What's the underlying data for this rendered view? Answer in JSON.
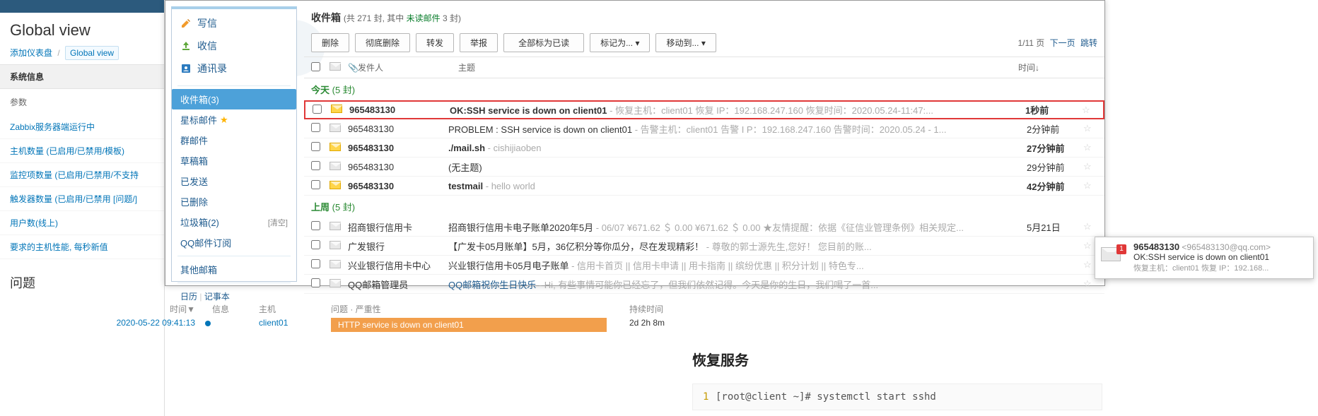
{
  "zabbix": {
    "title": "Global view",
    "bc_add": "添加仪表盘",
    "bc_cur": "Global view",
    "sysinfo_hd": "系统信息",
    "param": "参数",
    "links": [
      "Zabbix服务器端运行中",
      "主机数量 (已启用/已禁用/模板)",
      "监控项数量 (已启用/已禁用/不支持",
      "触发器数量 (已启用/已禁用 [问题/]",
      "用户数(线上)",
      "要求的主机性能, 每秒新值"
    ],
    "problems_hd": "问题"
  },
  "sidebar": {
    "compose": "写信",
    "receive": "收信",
    "contacts": "通讯录",
    "folders": {
      "inbox": "收件箱(3)",
      "starred": "星标邮件",
      "group": "群邮件",
      "drafts": "草稿箱",
      "sent": "已发送",
      "deleted": "已删除",
      "junk": "垃圾箱(2)",
      "junk_clear": "[清空]",
      "subscr": "QQ邮件订阅",
      "other": "其他邮箱"
    },
    "foot_cal": "日历",
    "foot_note": "记事本"
  },
  "mailbox": {
    "title": "收件箱",
    "stat_a": "(共 ",
    "stat_total": "271",
    "stat_b": " 封, 其中 ",
    "stat_unread_label": "未读邮件",
    "stat_unread": " 3",
    "stat_c": " 封)",
    "toolbar": {
      "del": "删除",
      "perm_del": "彻底删除",
      "fwd": "转发",
      "report": "举报",
      "mark_read": "全部标为已读",
      "mark_as": "标记为...",
      "move_to": "移动到..."
    },
    "pager": {
      "pg": "1/11 页",
      "next": "下一页",
      "jump": "跳转"
    },
    "cols": {
      "sender": "发件人",
      "subject": "主题",
      "time": "时间↓"
    },
    "groups": {
      "today": "今天",
      "today_cnt": "(5 封)",
      "lastweek": "上周",
      "lastweek_cnt": "(5 封)"
    },
    "rows": [
      {
        "bold": true,
        "hl": true,
        "unread": true,
        "sender": "965483130",
        "subject": "OK:SSH service is down on client01",
        "tail": " - 恢复主机：client01 恢复 IP：192.168.247.160 恢复时间：2020.05.24-11:47:...",
        "time": "1秒前"
      },
      {
        "bold": false,
        "hl": false,
        "unread": false,
        "sender": "965483130",
        "subject": "PROBLEM : SSH service is down on client01",
        "tail": " - 告警主机：client01 告警 I P：192.168.247.160 告警时间：2020.05.24 - 1...",
        "time": "2分钟前"
      },
      {
        "bold": true,
        "hl": false,
        "unread": true,
        "sender": "965483130",
        "subject": "./mail.sh",
        "tail": " - cishijiaoben",
        "time": "27分钟前"
      },
      {
        "bold": false,
        "hl": false,
        "unread": false,
        "sender": "965483130",
        "subject": "(无主题)",
        "tail": "",
        "time": "29分钟前"
      },
      {
        "bold": true,
        "hl": false,
        "unread": true,
        "sender": "965483130",
        "subject": "testmail",
        "tail": " - hello world",
        "time": "42分钟前"
      }
    ],
    "rows2": [
      {
        "sender": "招商银行信用卡",
        "subject": "招商银行信用卡电子账单2020年5月",
        "tail": " - 06/07 ¥671.62 ＄ 0.00 ¥671.62 ＄ 0.00 ★友情提醒：依据《征信业管理条例》相关规定...",
        "time": "5月21日"
      },
      {
        "sender": "广发银行",
        "subject": "【广发卡05月账单】5月，36亿积分等你瓜分，尽在发现精彩！",
        "tail": " - 尊敬的郭士源先生,您好！ 您目前的账...",
        "time": ""
      },
      {
        "sender": "兴业银行信用卡中心",
        "subject": "兴业银行信用卡05月电子账单",
        "tail": " - 信用卡首页 || 信用卡申请 || 用卡指南 || 缤纷优惠 || 积分计划 || 特色专...",
        "time": ""
      },
      {
        "sender": "QQ邮箱管理员",
        "subject": "",
        "link": "QQ邮箱祝你生日快乐",
        "tail": " - Hi, 有些事情可能你已经忘了，但我们依然记得。今天是你的生日，我们喝了一首...",
        "time": ""
      }
    ]
  },
  "ptable": {
    "h_time": "时间▼",
    "h_info": "信息",
    "h_host": "主机",
    "h_prob": "问题 · 严重性",
    "h_dur": "持续时间",
    "r_time": "2020-05-22 09:41:13",
    "r_host": "client01",
    "r_prob": "HTTP service is down on client01",
    "r_dur": "2d 2h 8m"
  },
  "rpanel": {
    "title": "恢复服务",
    "cmd": "[root@client ~]# systemctl start sshd"
  },
  "notif": {
    "name": "965483130",
    "email": "<965483130@qq.com>",
    "body": "OK:SSH service is down on client01",
    "foot": "恢复主机：client01 恢复 IP：192.168...",
    "badge": "1"
  }
}
